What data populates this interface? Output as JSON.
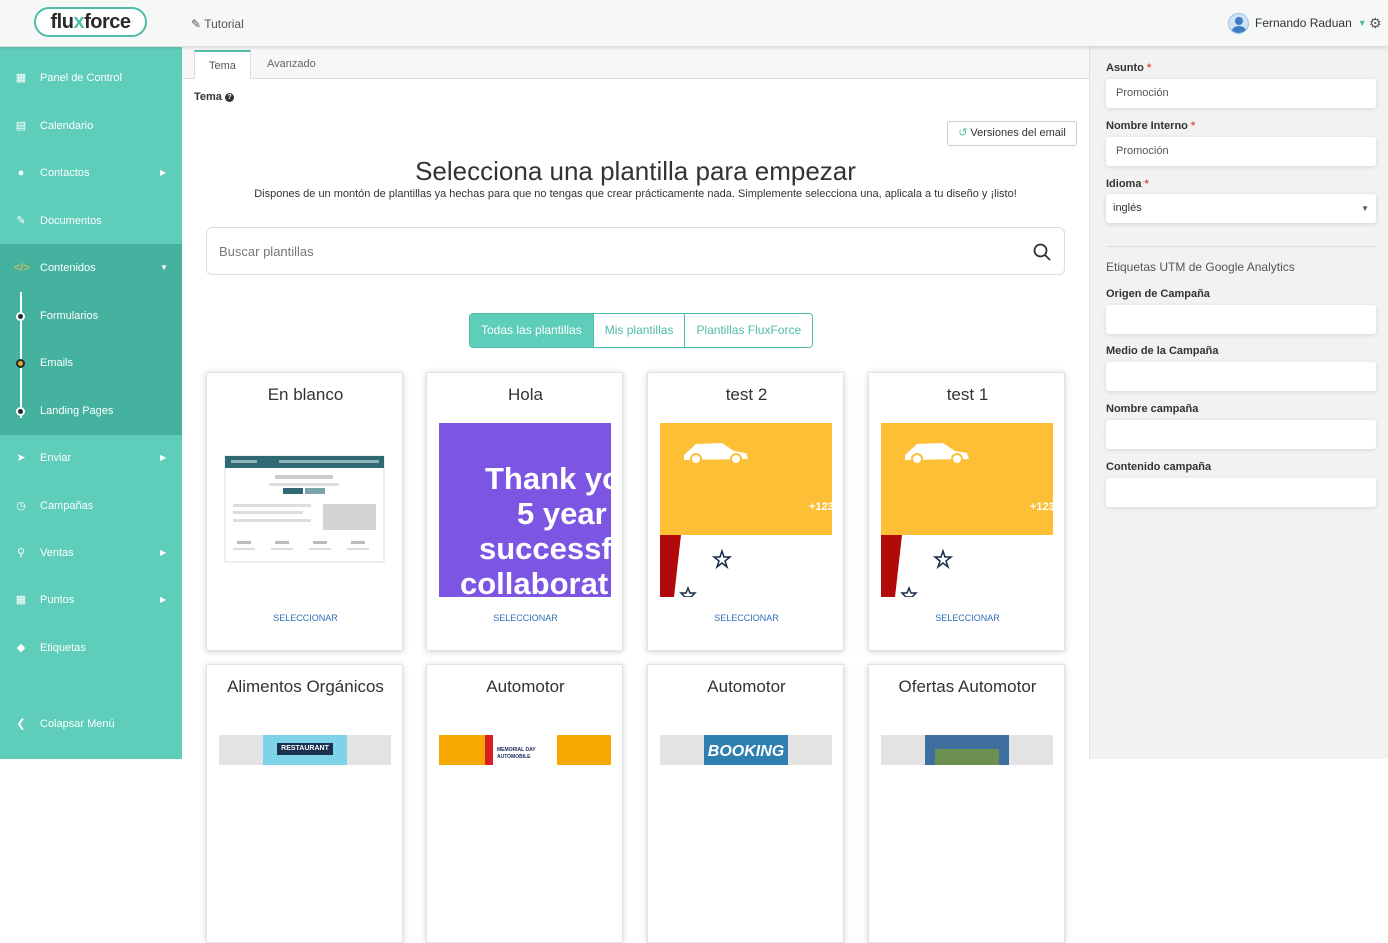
{
  "header": {
    "logo_text_1": "flu",
    "logo_text_2": "x",
    "logo_text_3": "force",
    "tutorial_label": "Tutorial",
    "user_name": "Fernando Raduan"
  },
  "sidebar": {
    "items": [
      {
        "label": "Panel de Control",
        "icon": "dashboard-icon"
      },
      {
        "label": "Calendario",
        "icon": "calendar-icon"
      },
      {
        "label": "Contactos",
        "icon": "user-icon"
      },
      {
        "label": "Documentos",
        "icon": "paperclip-icon"
      },
      {
        "label": "Contenidos",
        "icon": "code-icon"
      },
      {
        "label": "Enviar",
        "icon": "paper-plane-icon"
      },
      {
        "label": "Campañas",
        "icon": "clock-icon"
      },
      {
        "label": "Ventas",
        "icon": "map-marker-icon"
      },
      {
        "label": "Puntos",
        "icon": "calculator-icon"
      },
      {
        "label": "Etiquetas",
        "icon": "tag-icon"
      }
    ],
    "subitems": [
      {
        "label": "Formularios"
      },
      {
        "label": "Emails"
      },
      {
        "label": "Landing Pages"
      }
    ],
    "collapse_label": "Colapsar Menú"
  },
  "tabs": {
    "tema": "Tema",
    "avanzado": "Avanzado"
  },
  "tema_label": "Tema",
  "versions_button": "Versiones del email",
  "main_title": "Selecciona una plantilla para empezar",
  "main_desc": "Dispones de un montón de plantillas ya hechas para que no tengas que crear prácticamente nada. Simplemente selecciona una, aplicala a tu diseño y ¡listo!",
  "search_placeholder": "Buscar plantillas",
  "filters": [
    "Todas las plantillas",
    "Mis plantillas",
    "Plantillas FluxForce"
  ],
  "select_label": "SELECCIONAR",
  "cards": [
    {
      "title": "En blanco"
    },
    {
      "title": "Hola",
      "thumb_text": [
        "Thank yo",
        "5 year",
        "successf",
        "collaborat"
      ]
    },
    {
      "title": "test 2",
      "thumb_text": "+123"
    },
    {
      "title": "test 1",
      "thumb_text": "+123"
    },
    {
      "title": "Alimentos Orgánicos",
      "thumb_text": "RESTAURANT"
    },
    {
      "title": "Automotor",
      "thumb_text": [
        "MEMORIAL DAY",
        "AUTOMOBILE"
      ]
    },
    {
      "title": "Automotor",
      "thumb_text": "BOOKING"
    },
    {
      "title": "Ofertas Automotor"
    }
  ],
  "form": {
    "asunto_label": "Asunto",
    "asunto_value": "Promoción",
    "nombre_interno_label": "Nombre Interno",
    "nombre_interno_value": "Promoción",
    "idioma_label": "Idioma",
    "idioma_value": "inglés",
    "required_mark": "*",
    "utm_title": "Etiquetas UTM de Google Analytics",
    "origen_label": "Origen de Campaña",
    "medio_label": "Medio de la Campaña",
    "nombre_campana_label": "Nombre campaña",
    "contenido_label": "Contenido campaña"
  },
  "colors": {
    "accent": "#5ecdb9",
    "accent_dark": "#45b29f",
    "link": "#2f6fb5",
    "yellow": "#fcbf36",
    "purple": "#7c55e3"
  }
}
